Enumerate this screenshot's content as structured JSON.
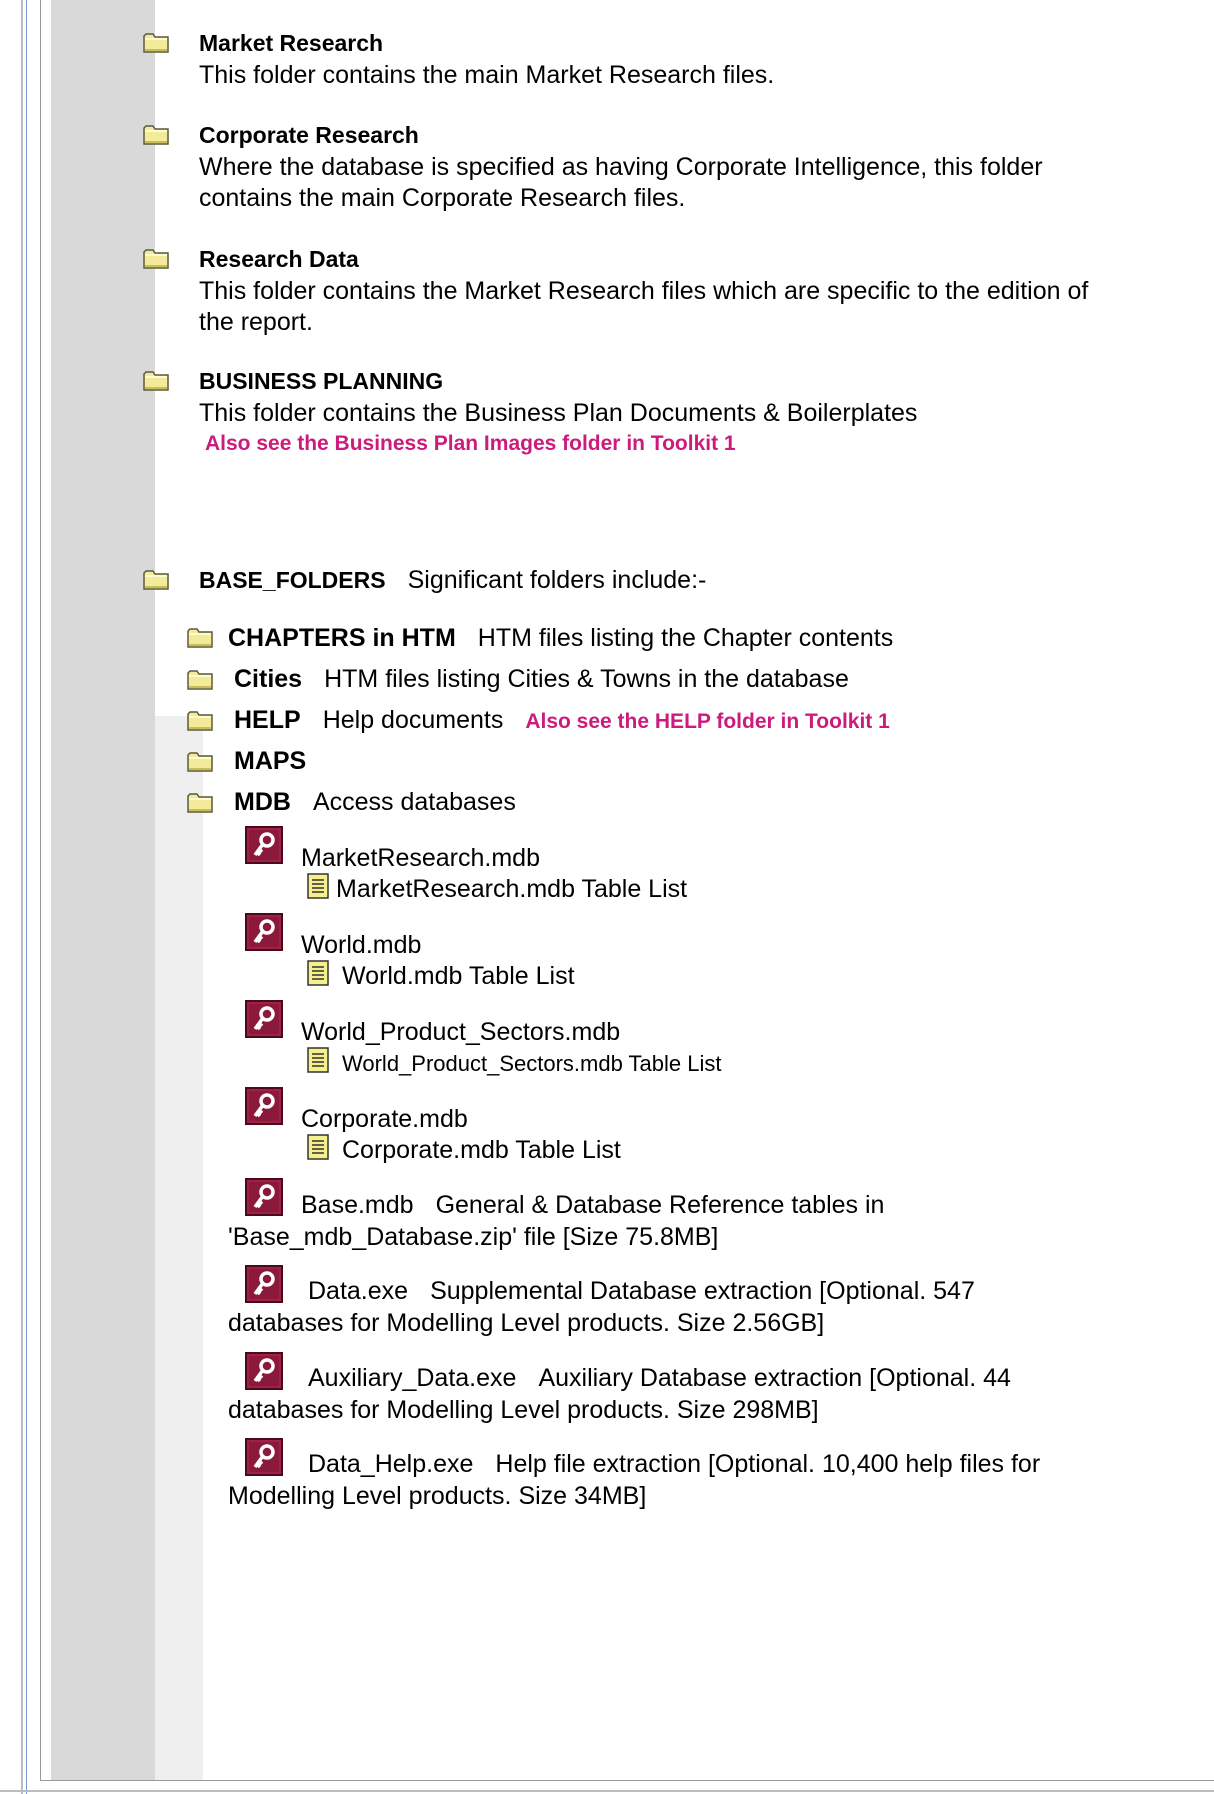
{
  "folders": [
    {
      "title": "Market Research",
      "desc": [
        "This folder contains the main Market Research files."
      ]
    },
    {
      "title": "Corporate Research",
      "desc": [
        "Where the database is specified as having Corporate Intelligence, this folder",
        "contains the main Corporate Research files."
      ]
    },
    {
      "title": "Research Data",
      "desc": [
        "This folder contains the Market Research files which are specific to the edition of",
        "the report."
      ]
    },
    {
      "title": "BUSINESS PLANNING",
      "desc": [
        "This folder contains the Business Plan Documents & Boilerplates"
      ],
      "note": "Also see the Business Plan Images folder in Toolkit 1"
    }
  ],
  "base_folders": {
    "title": "BASE_FOLDERS",
    "desc": "Significant folders include:-",
    "subfolders": [
      {
        "title": "CHAPTERS in HTM",
        "desc": "HTM files listing the Chapter contents"
      },
      {
        "title": "Cities",
        "desc": "HTM files listing Cities & Towns in the database"
      },
      {
        "title": "HELP",
        "desc": "Help documents",
        "note": "Also see the HELP folder in Toolkit 1"
      },
      {
        "title": "MAPS",
        "desc": ""
      },
      {
        "title": "MDB",
        "desc": "Access databases"
      }
    ]
  },
  "databases": [
    {
      "name": "MarketResearch.mdb",
      "table_list": "MarketResearch.mdb Table List"
    },
    {
      "name": "World.mdb",
      "table_list": "World.mdb Table List"
    },
    {
      "name": "World_Product_Sectors.mdb",
      "table_list": "World_Product_Sectors.mdb Table List"
    },
    {
      "name": "Corporate.mdb",
      "table_list": "Corporate.mdb Table List"
    }
  ],
  "extractions": [
    {
      "name": "Base.mdb",
      "line1": "General & Database Reference tables in",
      "line2": "'Base_mdb_Database.zip' file [Size 75.8MB]"
    },
    {
      "name": "Data.exe",
      "line1": "Supplemental Database extraction [Optional. 547",
      "line2": "databases for Modelling Level products. Size 2.56GB]"
    },
    {
      "name": "Auxiliary_Data.exe",
      "line1": "Auxiliary Database extraction [Optional. 44",
      "line2": "databases for Modelling Level products. Size 298MB]"
    },
    {
      "name": "Data_Help.exe",
      "line1": "Help file extraction [Optional. 10,400 help files for",
      "line2": "Modelling Level products. Size 34MB]"
    }
  ],
  "colors": {
    "note_pink": "#cc1b7c",
    "folder_yellow": "#f0e68c",
    "access_maroon": "#8b1a3a"
  }
}
